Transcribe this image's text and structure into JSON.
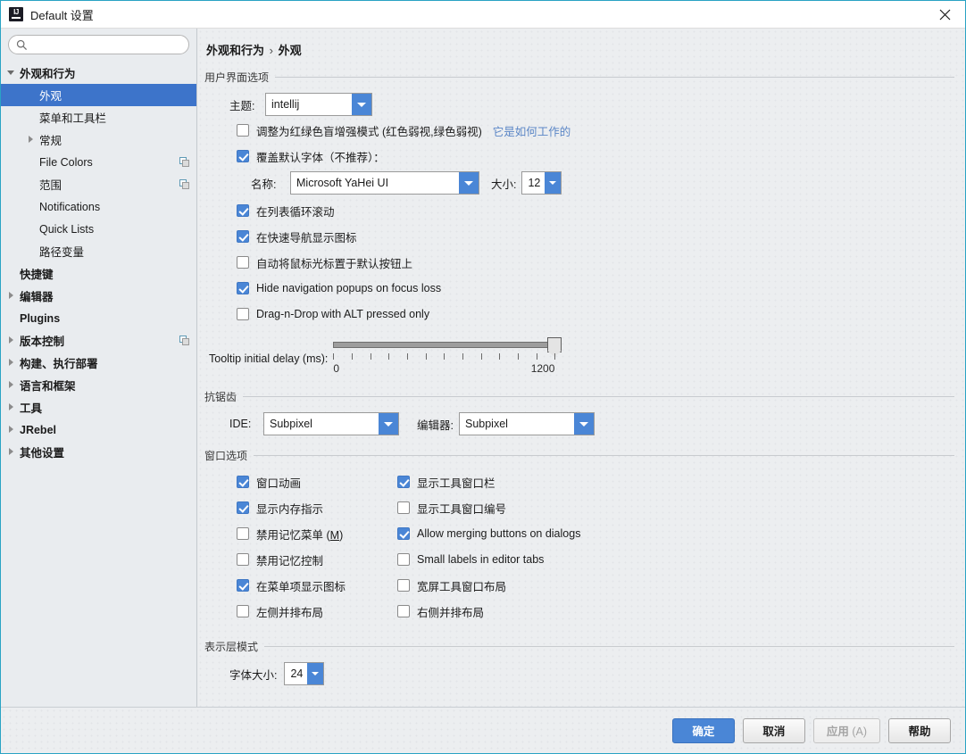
{
  "window": {
    "title": "Default 设置",
    "app_icon": "intellij-idea-icon",
    "close_icon": "close-icon",
    "accent": "#29a3c4"
  },
  "search": {
    "value": "",
    "placeholder": "",
    "icon": "search-icon"
  },
  "sidebar": {
    "items": [
      {
        "label": "外观和行为",
        "indent": 0,
        "twisty": "expanded",
        "bold": true,
        "selected": false,
        "copy": false
      },
      {
        "label": "外观",
        "indent": 1,
        "twisty": "none",
        "bold": false,
        "selected": true,
        "copy": false
      },
      {
        "label": "菜单和工具栏",
        "indent": 1,
        "twisty": "none",
        "bold": false,
        "selected": false,
        "copy": false
      },
      {
        "label": "常规",
        "indent": 1,
        "twisty": "collapsed",
        "bold": false,
        "selected": false,
        "copy": false
      },
      {
        "label": "File Colors",
        "indent": 1,
        "twisty": "none",
        "bold": false,
        "selected": false,
        "copy": true
      },
      {
        "label": "范围",
        "indent": 1,
        "twisty": "none",
        "bold": false,
        "selected": false,
        "copy": true
      },
      {
        "label": "Notifications",
        "indent": 1,
        "twisty": "none",
        "bold": false,
        "selected": false,
        "copy": false
      },
      {
        "label": "Quick Lists",
        "indent": 1,
        "twisty": "none",
        "bold": false,
        "selected": false,
        "copy": false
      },
      {
        "label": "路径变量",
        "indent": 1,
        "twisty": "none",
        "bold": false,
        "selected": false,
        "copy": false
      },
      {
        "label": "快捷键",
        "indent": 0,
        "twisty": "none",
        "bold": true,
        "selected": false,
        "copy": false
      },
      {
        "label": "编辑器",
        "indent": 0,
        "twisty": "collapsed",
        "bold": true,
        "selected": false,
        "copy": false
      },
      {
        "label": "Plugins",
        "indent": 0,
        "twisty": "none",
        "bold": true,
        "selected": false,
        "copy": false
      },
      {
        "label": "版本控制",
        "indent": 0,
        "twisty": "collapsed",
        "bold": true,
        "selected": false,
        "copy": true
      },
      {
        "label": "构建、执行部署",
        "indent": 0,
        "twisty": "collapsed",
        "bold": true,
        "selected": false,
        "copy": false
      },
      {
        "label": "语言和框架",
        "indent": 0,
        "twisty": "collapsed",
        "bold": true,
        "selected": false,
        "copy": false
      },
      {
        "label": "工具",
        "indent": 0,
        "twisty": "collapsed",
        "bold": true,
        "selected": false,
        "copy": false
      },
      {
        "label": "JRebel",
        "indent": 0,
        "twisty": "collapsed",
        "bold": true,
        "selected": false,
        "copy": false
      },
      {
        "label": "其他设置",
        "indent": 0,
        "twisty": "collapsed",
        "bold": true,
        "selected": false,
        "copy": false
      }
    ]
  },
  "main": {
    "breadcrumb": {
      "parent": "外观和行为",
      "separator": "›",
      "current": "外观"
    },
    "ui_options": {
      "title": "用户界面选项",
      "theme_label": "主题:",
      "theme_value": "intellij",
      "colorblind_label": "调整为红绿色盲增强模式 (红色弱视,绿色弱视)",
      "colorblind_checked": false,
      "colorblind_link": "它是如何工作的",
      "override_font_label": "覆盖默认字体（不推荐）：",
      "override_font_checked": true,
      "font_name_label": "名称:",
      "font_name_value": "Microsoft YaHei UI",
      "font_size_label": "大小:",
      "font_size_value": "12",
      "checkboxes": [
        {
          "label": "在列表循环滚动",
          "checked": true
        },
        {
          "label": "在快速导航显示图标",
          "checked": true
        },
        {
          "label": "自动将鼠标光标置于默认按钮上",
          "checked": false
        },
        {
          "label": "Hide navigation popups on focus loss",
          "checked": true
        },
        {
          "label": "Drag-n-Drop with ALT pressed only",
          "checked": false
        }
      ],
      "tooltip_delay_label": "Tooltip initial delay (ms):",
      "tooltip_delay_min": "0",
      "tooltip_delay_max": "1200",
      "tooltip_delay_value": "1200"
    },
    "antialiasing": {
      "title": "抗锯齿",
      "ide_label": "IDE:",
      "ide_value": "Subpixel",
      "editor_label": "编辑器:",
      "editor_value": "Subpixel"
    },
    "window_options": {
      "title": "窗口选项",
      "left_column": [
        {
          "label": "窗口动画",
          "checked": true
        },
        {
          "label": "显示内存指示",
          "checked": true
        },
        {
          "label": "禁用记忆菜单 (M)",
          "checked": false,
          "mnemonic": "M"
        },
        {
          "label": "禁用记忆控制",
          "checked": false
        },
        {
          "label": "在菜单项显示图标",
          "checked": true
        },
        {
          "label": "左侧并排布局",
          "checked": false
        }
      ],
      "right_column": [
        {
          "label": "显示工具窗口栏",
          "checked": true
        },
        {
          "label": "显示工具窗口编号",
          "checked": false
        },
        {
          "label": "Allow merging buttons on dialogs",
          "checked": true
        },
        {
          "label": "Small labels in editor tabs",
          "checked": false
        },
        {
          "label": "宽屏工具窗口布局",
          "checked": false
        },
        {
          "label": "右侧并排布局",
          "checked": false
        }
      ]
    },
    "presentation_mode": {
      "title": "表示层模式",
      "font_size_label": "字体大小:",
      "font_size_value": "24"
    }
  },
  "footer": {
    "ok": "确定",
    "cancel": "取消",
    "apply": "应用",
    "apply_mnemonic": "(A)",
    "apply_disabled": true,
    "help": "帮助"
  }
}
